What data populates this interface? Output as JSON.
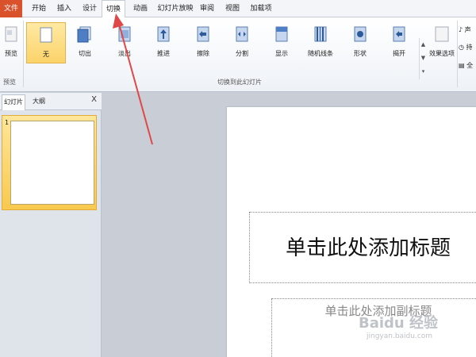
{
  "menu": {
    "tabs": [
      {
        "label": "文件"
      },
      {
        "label": "开始"
      },
      {
        "label": "插入"
      },
      {
        "label": "设计"
      },
      {
        "label": "切换"
      },
      {
        "label": "动画"
      },
      {
        "label": "幻灯片放映"
      },
      {
        "label": "审阅"
      },
      {
        "label": "视图"
      },
      {
        "label": "加载项"
      }
    ],
    "active_tab": "切换"
  },
  "ribbon": {
    "preview": {
      "label": "预览",
      "group_label": "预览"
    },
    "transitions": [
      {
        "label": "无",
        "icon": "blank-icon",
        "selected": true
      },
      {
        "label": "切出",
        "icon": "cut-icon"
      },
      {
        "label": "淡出",
        "icon": "fade-icon"
      },
      {
        "label": "推进",
        "icon": "push-icon"
      },
      {
        "label": "擦除",
        "icon": "wipe-icon"
      },
      {
        "label": "分割",
        "icon": "split-icon"
      },
      {
        "label": "显示",
        "icon": "reveal-icon"
      },
      {
        "label": "随机线条",
        "icon": "random-bars-icon"
      },
      {
        "label": "形状",
        "icon": "shape-icon"
      },
      {
        "label": "揭开",
        "icon": "uncover-icon"
      }
    ],
    "transitions_group_label": "切换到此幻灯片",
    "effect_options_label": "效果选项",
    "timing": [
      "声",
      "持",
      "全"
    ]
  },
  "left_panel": {
    "tabs": [
      "幻灯片",
      "大纲"
    ],
    "close_label": "X",
    "slides": [
      {
        "number": "1"
      }
    ]
  },
  "slide": {
    "title_placeholder": "单击此处添加标题",
    "subtitle_placeholder": "单击此处添加副标题"
  },
  "watermark": {
    "main": "Baidu 经验",
    "sub": "jingyan.baidu.com"
  },
  "colors": {
    "file_tab": "#d9522c",
    "selected_button": "#fbd36a",
    "slide_panel_highlight": "#f8c94e",
    "annotation_arrow": "#e04848"
  }
}
